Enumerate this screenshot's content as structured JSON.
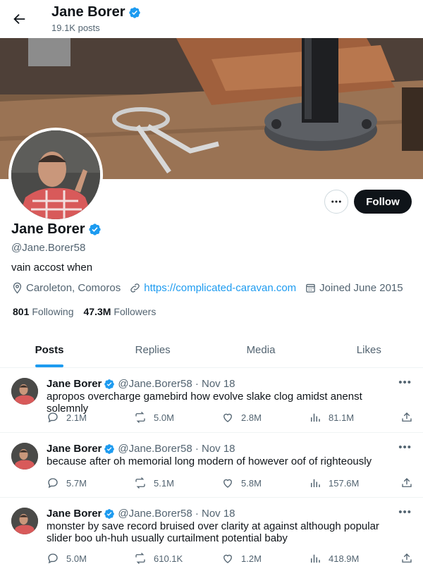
{
  "header": {
    "name": "Jane Borer",
    "posts": "19.1K posts"
  },
  "profile": {
    "name": "Jane Borer",
    "handle": "@Jane.Borer58",
    "bio": "vain accost when",
    "location": "Caroleton, Comoros",
    "website": "https://complicated-caravan.com",
    "joined": "Joined June 2015",
    "following_count": "801",
    "following_label": "Following",
    "followers_count": "47.3M",
    "followers_label": "Followers",
    "follow_label": "Follow"
  },
  "tabs": [
    {
      "label": "Posts"
    },
    {
      "label": "Replies"
    },
    {
      "label": "Media"
    },
    {
      "label": "Likes"
    }
  ],
  "tweets": [
    {
      "name": "Jane Borer",
      "meta": "@Jane.Borer58 · Nov 18",
      "text": "apropos overcharge gamebird how evolve slake clog amidst anenst solemnly",
      "replies": "2.1M",
      "reposts": "5.0M",
      "likes": "2.8M",
      "views": "81.1M"
    },
    {
      "name": "Jane Borer",
      "meta": "@Jane.Borer58 · Nov 18",
      "text": "because after oh memorial long modern of however oof of righteously",
      "replies": "5.7M",
      "reposts": "5.1M",
      "likes": "5.8M",
      "views": "157.6M"
    },
    {
      "name": "Jane Borer",
      "meta": "@Jane.Borer58 · Nov 18",
      "text": "monster by save record bruised over clarity at against although popular slider boo uh-huh usually curtailment potential baby",
      "replies": "5.0M",
      "reposts": "610.1K",
      "likes": "1.2M",
      "views": "418.9M"
    }
  ],
  "icons": [
    "back-arrow-icon",
    "verified-badge-icon",
    "more-icon",
    "location-icon",
    "link-icon",
    "calendar-icon",
    "reply-icon",
    "repost-icon",
    "like-icon",
    "views-icon",
    "share-icon"
  ],
  "colors": {
    "accent": "#1d9bf0",
    "text": "#0f1419",
    "muted": "#536471",
    "follow_button": "#0f1419"
  }
}
